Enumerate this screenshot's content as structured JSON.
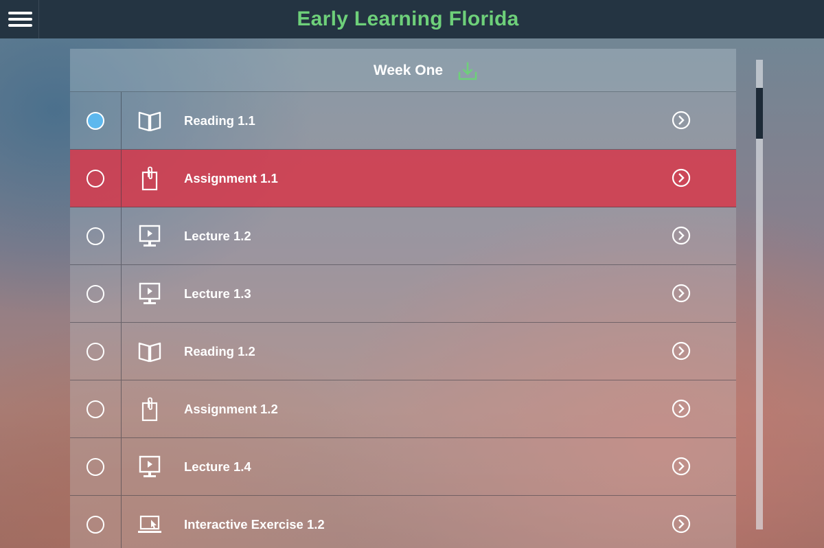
{
  "app": {
    "title": "Early Learning Florida",
    "title_color": "#6ed07a",
    "header_bg": "#243442"
  },
  "menu": {
    "icon": "hamburger-menu-icon"
  },
  "week": {
    "title": "Week One",
    "download_icon": "download-icon",
    "download_icon_color": "#6ed07a"
  },
  "items": [
    {
      "label": "Reading 1.1",
      "type": "reading",
      "icon": "open-book-icon",
      "selected": true,
      "active": false
    },
    {
      "label": "Assignment 1.1",
      "type": "assignment",
      "icon": "clipboard-paperclip-icon",
      "selected": false,
      "active": true
    },
    {
      "label": "Lecture 1.2",
      "type": "lecture",
      "icon": "monitor-play-icon",
      "selected": false,
      "active": false
    },
    {
      "label": "Lecture 1.3",
      "type": "lecture",
      "icon": "monitor-play-icon",
      "selected": false,
      "active": false
    },
    {
      "label": "Reading 1.2",
      "type": "reading",
      "icon": "open-book-icon",
      "selected": false,
      "active": false
    },
    {
      "label": "Assignment 1.2",
      "type": "assignment",
      "icon": "clipboard-paperclip-icon",
      "selected": false,
      "active": false
    },
    {
      "label": "Lecture 1.4",
      "type": "lecture",
      "icon": "monitor-play-icon",
      "selected": false,
      "active": false
    },
    {
      "label": "Interactive Exercise 1.2",
      "type": "interactive",
      "icon": "laptop-cursor-icon",
      "selected": false,
      "active": false
    }
  ],
  "colors": {
    "active_row": "#d63e50",
    "selected_radio": "#5db8ee",
    "scroll_thumb": "#1d2a37"
  }
}
